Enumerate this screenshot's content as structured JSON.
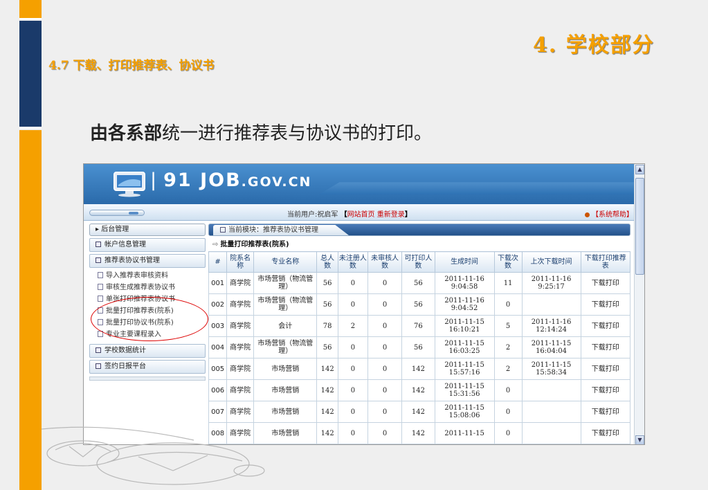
{
  "slide": {
    "title": "4. 学校部分",
    "subtitle": "4.7 下载、打印推荐表、协议书",
    "body_bold": "由各系部",
    "body_rest": "统一进行推荐表与协议书的打印。"
  },
  "app": {
    "brand_num": "91",
    "brand_job": "JOB",
    "brand_domain": ".GOV.CN",
    "user_prefix": "当前用户:",
    "user_name": "祝启军",
    "bracket_open": "【",
    "link_home": "网站首页",
    "link_relogin": "重新登录",
    "bracket_close": "】",
    "help": "【系统帮助】"
  },
  "sidebar": {
    "header": "后台管理",
    "sections": [
      {
        "label": "帐户信息管理"
      },
      {
        "label": "推荐表协议书管理"
      },
      {
        "label": "学校数据统计"
      },
      {
        "label": "签约日报平台"
      }
    ],
    "items": [
      {
        "label": "导入推荐表审核资料"
      },
      {
        "label": "审核生成推荐表协议书"
      },
      {
        "label": "单张打印推荐表协议书"
      },
      {
        "label": "批量打印推荐表(院系)"
      },
      {
        "label": "批量打印协议书(院系)"
      },
      {
        "label": "专业主要课程录入"
      }
    ]
  },
  "main": {
    "module_tab": "当前模块：推荐表协议书管理",
    "section_icon": "⇨",
    "section_title": "批量打印推荐表(院系)",
    "columns": [
      "#",
      "院系名称",
      "专业名称",
      "总人数",
      "未注册人数",
      "未审核人数",
      "可打印人数",
      "生成时间",
      "下载次数",
      "上次下载时间",
      "下载打印推荐表"
    ],
    "rows": [
      {
        "no": "001",
        "dept": "商学院",
        "major": "市场营销（物流管理）",
        "total": "56",
        "unreg": "0",
        "unaudit": "0",
        "printable": "56",
        "gen_date": "2011-11-16",
        "gen_time": "9:04:58",
        "downloads": "11",
        "last_date": "2011-11-16",
        "last_time": "9:25:17",
        "action": "下载打印"
      },
      {
        "no": "002",
        "dept": "商学院",
        "major": "市场营销（物流管理）",
        "total": "56",
        "unreg": "0",
        "unaudit": "0",
        "printable": "56",
        "gen_date": "2011-11-16",
        "gen_time": "9:04:52",
        "downloads": "0",
        "last_date": "",
        "last_time": "",
        "action": "下载打印"
      },
      {
        "no": "003",
        "dept": "商学院",
        "major": "会计",
        "total": "78",
        "unreg": "2",
        "unaudit": "0",
        "printable": "76",
        "gen_date": "2011-11-15",
        "gen_time": "16:10:21",
        "downloads": "5",
        "last_date": "2011-11-16",
        "last_time": "12:14:24",
        "action": "下载打印"
      },
      {
        "no": "004",
        "dept": "商学院",
        "major": "市场营销（物流管理）",
        "total": "56",
        "unreg": "0",
        "unaudit": "0",
        "printable": "56",
        "gen_date": "2011-11-15",
        "gen_time": "16:03:25",
        "downloads": "2",
        "last_date": "2011-11-15",
        "last_time": "16:04:04",
        "action": "下载打印"
      },
      {
        "no": "005",
        "dept": "商学院",
        "major": "市场营销",
        "total": "142",
        "unreg": "0",
        "unaudit": "0",
        "printable": "142",
        "gen_date": "2011-11-15",
        "gen_time": "15:57:16",
        "downloads": "2",
        "last_date": "2011-11-15",
        "last_time": "15:58:34",
        "action": "下载打印"
      },
      {
        "no": "006",
        "dept": "商学院",
        "major": "市场营销",
        "total": "142",
        "unreg": "0",
        "unaudit": "0",
        "printable": "142",
        "gen_date": "2011-11-15",
        "gen_time": "15:31:56",
        "downloads": "0",
        "last_date": "",
        "last_time": "",
        "action": "下载打印"
      },
      {
        "no": "007",
        "dept": "商学院",
        "major": "市场营销",
        "total": "142",
        "unreg": "0",
        "unaudit": "0",
        "printable": "142",
        "gen_date": "2011-11-15",
        "gen_time": "15:08:06",
        "downloads": "0",
        "last_date": "",
        "last_time": "",
        "action": "下载打印"
      },
      {
        "no": "008",
        "dept": "商学院",
        "major": "市场营销",
        "total": "142",
        "unreg": "0",
        "unaudit": "0",
        "printable": "142",
        "gen_date": "2011-11-15",
        "gen_time": "",
        "downloads": "0",
        "last_date": "",
        "last_time": "",
        "action": "下载打印"
      }
    ]
  },
  "colors": {
    "accent_orange": "#f5a000",
    "navy": "#1a3a6a",
    "banner_blue": "#2a6aaa",
    "link_red": "#cc0000"
  }
}
